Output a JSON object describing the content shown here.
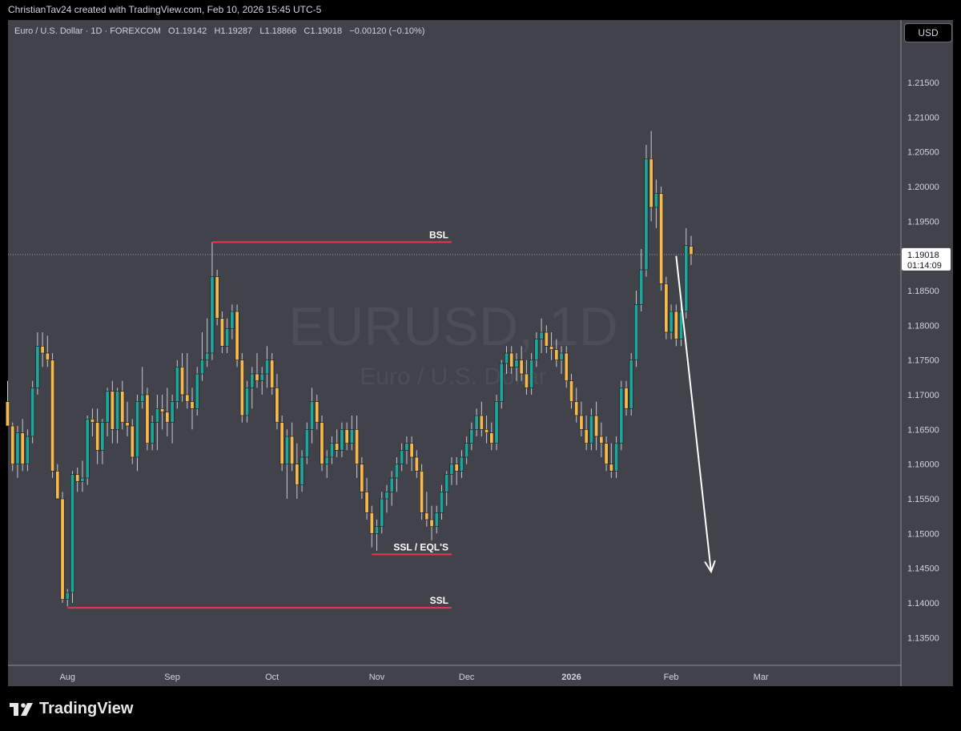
{
  "header": {
    "text": "ChristianTav24 created with TradingView.com, Feb 10, 2026 15:45 UTC-5"
  },
  "legend": {
    "symbol": "Euro / U.S. Dollar · 1D · FOREXCOM",
    "o_label": "O",
    "o": "1.19142",
    "h_label": "H",
    "h": "1.19287",
    "l_label": "L",
    "l": "1.18866",
    "c_label": "C",
    "c": "1.19018",
    "change": "−0.00120 (−0.10%)"
  },
  "currency_button": "USD",
  "watermark": {
    "symbol": "EURUSD, 1D",
    "name": "Euro / U.S. Dollar"
  },
  "price_label": {
    "price": "1.19018",
    "countdown": "01:14:09"
  },
  "brand": "TradingView",
  "colors": {
    "up": "#1fa59a",
    "down": "#f5b94f",
    "background": "#41424a",
    "level_line": "#f0354a",
    "axis_text": "#d1d4dc"
  },
  "chart_data": {
    "type": "candlestick",
    "symbol": "EURUSD",
    "interval": "1D",
    "ylim": [
      1.131,
      1.224
    ],
    "y_ticks": [
      "1.13500",
      "1.14000",
      "1.14500",
      "1.15000",
      "1.15500",
      "1.16000",
      "1.16500",
      "1.17000",
      "1.17500",
      "1.18000",
      "1.18500",
      "1.19000",
      "1.19500",
      "1.20000",
      "1.20500",
      "1.21000",
      "1.21500"
    ],
    "x_ticks": [
      {
        "label": "Aug",
        "bar": 12,
        "bold": false
      },
      {
        "label": "Sep",
        "bar": 33,
        "bold": false
      },
      {
        "label": "Oct",
        "bar": 53,
        "bold": false
      },
      {
        "label": "Nov",
        "bar": 74,
        "bold": false
      },
      {
        "label": "Dec",
        "bar": 92,
        "bold": false
      },
      {
        "label": "2026",
        "bar": 113,
        "bold": true
      },
      {
        "label": "Feb",
        "bar": 133,
        "bold": false
      },
      {
        "label": "Mar",
        "bar": 151,
        "bold": false
      }
    ],
    "candles": [
      [
        1.169,
        1.172,
        1.167,
        1.1655
      ],
      [
        1.1655,
        1.166,
        1.159,
        1.16
      ],
      [
        1.16,
        1.1655,
        1.158,
        1.1645
      ],
      [
        1.1645,
        1.1665,
        1.159,
        1.16
      ],
      [
        1.16,
        1.165,
        1.159,
        1.164
      ],
      [
        1.164,
        1.172,
        1.163,
        1.171
      ],
      [
        1.171,
        1.179,
        1.17,
        1.177
      ],
      [
        1.177,
        1.179,
        1.174,
        1.176
      ],
      [
        1.176,
        1.1785,
        1.174,
        1.175
      ],
      [
        1.175,
        1.176,
        1.158,
        1.159
      ],
      [
        1.159,
        1.16,
        1.155,
        1.155
      ],
      [
        1.155,
        1.156,
        1.14,
        1.1405
      ],
      [
        1.1405,
        1.142,
        1.1395,
        1.1415
      ],
      [
        1.1415,
        1.159,
        1.14,
        1.1585
      ],
      [
        1.1585,
        1.1595,
        1.156,
        1.1575
      ],
      [
        1.1575,
        1.1605,
        1.156,
        1.158
      ],
      [
        1.158,
        1.167,
        1.157,
        1.1665
      ],
      [
        1.1665,
        1.168,
        1.164,
        1.166
      ],
      [
        1.166,
        1.168,
        1.16,
        1.162
      ],
      [
        1.162,
        1.1665,
        1.16,
        1.166
      ],
      [
        1.166,
        1.171,
        1.164,
        1.1705
      ],
      [
        1.1705,
        1.172,
        1.163,
        1.165
      ],
      [
        1.165,
        1.171,
        1.163,
        1.1705
      ],
      [
        1.1705,
        1.172,
        1.165,
        1.166
      ],
      [
        1.166,
        1.169,
        1.164,
        1.1655
      ],
      [
        1.1655,
        1.1665,
        1.16,
        1.161
      ],
      [
        1.161,
        1.17,
        1.159,
        1.169
      ],
      [
        1.169,
        1.174,
        1.168,
        1.17
      ],
      [
        1.17,
        1.171,
        1.162,
        1.163
      ],
      [
        1.163,
        1.167,
        1.162,
        1.166
      ],
      [
        1.166,
        1.17,
        1.162,
        1.168
      ],
      [
        1.168,
        1.17,
        1.165,
        1.1675
      ],
      [
        1.1675,
        1.171,
        1.164,
        1.166
      ],
      [
        1.166,
        1.17,
        1.163,
        1.169
      ],
      [
        1.169,
        1.175,
        1.168,
        1.174
      ],
      [
        1.174,
        1.176,
        1.169,
        1.17
      ],
      [
        1.17,
        1.176,
        1.168,
        1.169
      ],
      [
        1.169,
        1.171,
        1.165,
        1.168
      ],
      [
        1.168,
        1.174,
        1.167,
        1.173
      ],
      [
        1.173,
        1.179,
        1.172,
        1.175
      ],
      [
        1.175,
        1.181,
        1.174,
        1.176
      ],
      [
        1.176,
        1.192,
        1.175,
        1.187
      ],
      [
        1.187,
        1.188,
        1.18,
        1.181
      ],
      [
        1.181,
        1.182,
        1.176,
        1.177
      ],
      [
        1.177,
        1.181,
        1.176,
        1.1795
      ],
      [
        1.1795,
        1.183,
        1.178,
        1.182
      ],
      [
        1.182,
        1.183,
        1.174,
        1.175
      ],
      [
        1.175,
        1.176,
        1.166,
        1.167
      ],
      [
        1.167,
        1.172,
        1.166,
        1.171
      ],
      [
        1.171,
        1.174,
        1.168,
        1.173
      ],
      [
        1.173,
        1.176,
        1.171,
        1.172
      ],
      [
        1.172,
        1.174,
        1.17,
        1.173
      ],
      [
        1.173,
        1.177,
        1.171,
        1.175
      ],
      [
        1.175,
        1.176,
        1.17,
        1.171
      ],
      [
        1.171,
        1.173,
        1.165,
        1.166
      ],
      [
        1.166,
        1.167,
        1.159,
        1.16
      ],
      [
        1.16,
        1.165,
        1.155,
        1.164
      ],
      [
        1.164,
        1.166,
        1.159,
        1.16
      ],
      [
        1.16,
        1.163,
        1.155,
        1.157
      ],
      [
        1.157,
        1.162,
        1.156,
        1.161
      ],
      [
        1.161,
        1.166,
        1.16,
        1.165
      ],
      [
        1.165,
        1.171,
        1.163,
        1.169
      ],
      [
        1.169,
        1.17,
        1.165,
        1.166
      ],
      [
        1.166,
        1.167,
        1.159,
        1.16
      ],
      [
        1.16,
        1.162,
        1.158,
        1.161
      ],
      [
        1.161,
        1.164,
        1.16,
        1.163
      ],
      [
        1.163,
        1.165,
        1.161,
        1.162
      ],
      [
        1.162,
        1.166,
        1.161,
        1.165
      ],
      [
        1.165,
        1.166,
        1.162,
        1.163
      ],
      [
        1.163,
        1.167,
        1.162,
        1.165
      ],
      [
        1.165,
        1.167,
        1.158,
        1.16
      ],
      [
        1.16,
        1.161,
        1.155,
        1.156
      ],
      [
        1.156,
        1.158,
        1.152,
        1.153
      ],
      [
        1.153,
        1.154,
        1.148,
        1.15
      ],
      [
        1.15,
        1.152,
        1.1475,
        1.151
      ],
      [
        1.151,
        1.156,
        1.15,
        1.155
      ],
      [
        1.155,
        1.157,
        1.153,
        1.156
      ],
      [
        1.156,
        1.159,
        1.154,
        1.158
      ],
      [
        1.158,
        1.161,
        1.156,
        1.16
      ],
      [
        1.16,
        1.163,
        1.159,
        1.162
      ],
      [
        1.162,
        1.164,
        1.16,
        1.163
      ],
      [
        1.163,
        1.164,
        1.159,
        1.161
      ],
      [
        1.161,
        1.162,
        1.158,
        1.159
      ],
      [
        1.159,
        1.16,
        1.152,
        1.153
      ],
      [
        1.153,
        1.156,
        1.151,
        1.152
      ],
      [
        1.152,
        1.154,
        1.149,
        1.151
      ],
      [
        1.151,
        1.154,
        1.15,
        1.153
      ],
      [
        1.153,
        1.157,
        1.152,
        1.156
      ],
      [
        1.156,
        1.159,
        1.154,
        1.1585
      ],
      [
        1.1585,
        1.161,
        1.157,
        1.16
      ],
      [
        1.16,
        1.161,
        1.157,
        1.159
      ],
      [
        1.159,
        1.162,
        1.158,
        1.161
      ],
      [
        1.161,
        1.164,
        1.16,
        1.163
      ],
      [
        1.163,
        1.166,
        1.162,
        1.165
      ],
      [
        1.165,
        1.168,
        1.164,
        1.167
      ],
      [
        1.167,
        1.169,
        1.164,
        1.165
      ],
      [
        1.165,
        1.167,
        1.163,
        1.1645
      ],
      [
        1.1645,
        1.166,
        1.162,
        1.163
      ],
      [
        1.163,
        1.17,
        1.162,
        1.169
      ],
      [
        1.169,
        1.175,
        1.168,
        1.1745
      ],
      [
        1.1745,
        1.177,
        1.173,
        1.176
      ],
      [
        1.176,
        1.177,
        1.173,
        1.174
      ],
      [
        1.174,
        1.176,
        1.172,
        1.175
      ],
      [
        1.175,
        1.177,
        1.172,
        1.173
      ],
      [
        1.173,
        1.175,
        1.17,
        1.171
      ],
      [
        1.171,
        1.176,
        1.17,
        1.175
      ],
      [
        1.175,
        1.179,
        1.174,
        1.178
      ],
      [
        1.178,
        1.181,
        1.176,
        1.179
      ],
      [
        1.179,
        1.18,
        1.176,
        1.177
      ],
      [
        1.177,
        1.179,
        1.175,
        1.1765
      ],
      [
        1.1765,
        1.178,
        1.174,
        1.175
      ],
      [
        1.175,
        1.177,
        1.173,
        1.176
      ],
      [
        1.176,
        1.177,
        1.171,
        1.172
      ],
      [
        1.172,
        1.173,
        1.168,
        1.169
      ],
      [
        1.169,
        1.171,
        1.166,
        1.167
      ],
      [
        1.167,
        1.169,
        1.164,
        1.165
      ],
      [
        1.165,
        1.167,
        1.162,
        1.163
      ],
      [
        1.163,
        1.168,
        1.162,
        1.167
      ],
      [
        1.167,
        1.169,
        1.162,
        1.164
      ],
      [
        1.164,
        1.166,
        1.161,
        1.163
      ],
      [
        1.163,
        1.164,
        1.159,
        1.16
      ],
      [
        1.16,
        1.163,
        1.158,
        1.159
      ],
      [
        1.159,
        1.164,
        1.158,
        1.163
      ],
      [
        1.163,
        1.172,
        1.162,
        1.171
      ],
      [
        1.171,
        1.172,
        1.167,
        1.168
      ],
      [
        1.168,
        1.176,
        1.167,
        1.175
      ],
      [
        1.175,
        1.185,
        1.174,
        1.183
      ],
      [
        1.183,
        1.191,
        1.182,
        1.188
      ],
      [
        1.188,
        1.206,
        1.187,
        1.204
      ],
      [
        1.204,
        1.208,
        1.195,
        1.197
      ],
      [
        1.197,
        1.201,
        1.194,
        1.199
      ],
      [
        1.199,
        1.2,
        1.185,
        1.186
      ],
      [
        1.186,
        1.187,
        1.178,
        1.179
      ],
      [
        1.179,
        1.183,
        1.178,
        1.182
      ],
      [
        1.182,
        1.183,
        1.177,
        1.178
      ],
      [
        1.178,
        1.183,
        1.177,
        1.182
      ],
      [
        1.182,
        1.194,
        1.181,
        1.1915
      ],
      [
        1.1914,
        1.1929,
        1.1887,
        1.1902
      ]
    ],
    "levels": [
      {
        "label": "BSL",
        "price": 1.192,
        "from_bar": 41,
        "to_bar": 89
      },
      {
        "label": "SSL / EQL'S",
        "price": 1.147,
        "from_bar": 73,
        "to_bar": 89
      },
      {
        "label": "SSL",
        "price": 1.1393,
        "from_bar": 12,
        "to_bar": 89
      }
    ],
    "arrow": {
      "from_bar": 134,
      "from_price": 1.19,
      "to_bar": 141,
      "to_price": 1.1445
    }
  }
}
